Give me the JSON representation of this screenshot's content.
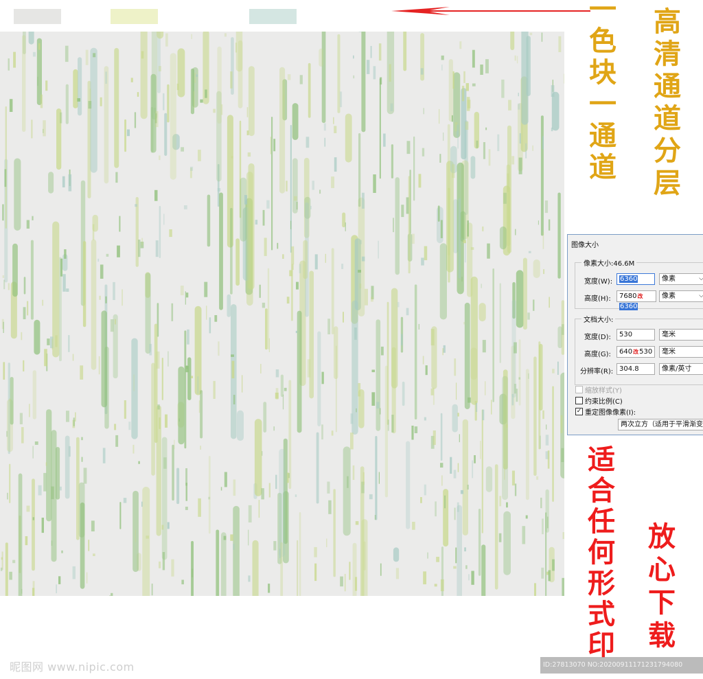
{
  "swatches": [
    {
      "name": "grey",
      "color": "#e6e6e4"
    },
    {
      "name": "yellow-green",
      "color": "#eef2c8"
    },
    {
      "name": "teal",
      "color": "#d4e6e2"
    }
  ],
  "pattern_colors": {
    "base": "#ebebea",
    "green": "#8fc07a",
    "yellow_green": "#c8d88c",
    "teal": "#a7cbc3"
  },
  "annotations": {
    "gold_vertical_1": [
      "高",
      "清",
      "通",
      "道",
      "分",
      "层"
    ],
    "gold_vertical_2": [
      "一",
      "色",
      "块",
      "一",
      "通",
      "道"
    ],
    "red_vertical_1": [
      "适",
      "合",
      "任",
      "何",
      "形",
      "式",
      "印"
    ],
    "red_vertical_2": [
      "放",
      "心",
      "下",
      "载"
    ]
  },
  "dialog": {
    "title": "图像大小",
    "pixel_group_label": "像素大小:46.6M",
    "width_label": "宽度(W):",
    "width_value": "6360",
    "width_unit": "像素",
    "height_label": "高度(H):",
    "height_value_old": "7680",
    "height_value_new": "6360",
    "height_unit": "像素",
    "doc_group_label": "文档大小:",
    "doc_width_label": "宽度(D):",
    "doc_width_value": "530",
    "doc_width_unit": "毫米",
    "doc_height_label": "高度(G):",
    "doc_height_value_old": "640",
    "doc_height_value_new": "530",
    "doc_height_unit": "毫米",
    "resolution_label": "分辨率(R):",
    "resolution_value": "304.8",
    "resolution_unit": "像素/英寸",
    "scale_styles_label": "缩放样式(Y)",
    "constrain_label": "约束比例(C)",
    "resample_label": "重定图像像素(I):",
    "resample_method": "两次立方（适用于平滑渐变）",
    "red_mark": "改"
  },
  "watermarks": {
    "left": "昵图网 www.nipic.com",
    "right": "ID:27813070 NO:20200911171231794080"
  }
}
